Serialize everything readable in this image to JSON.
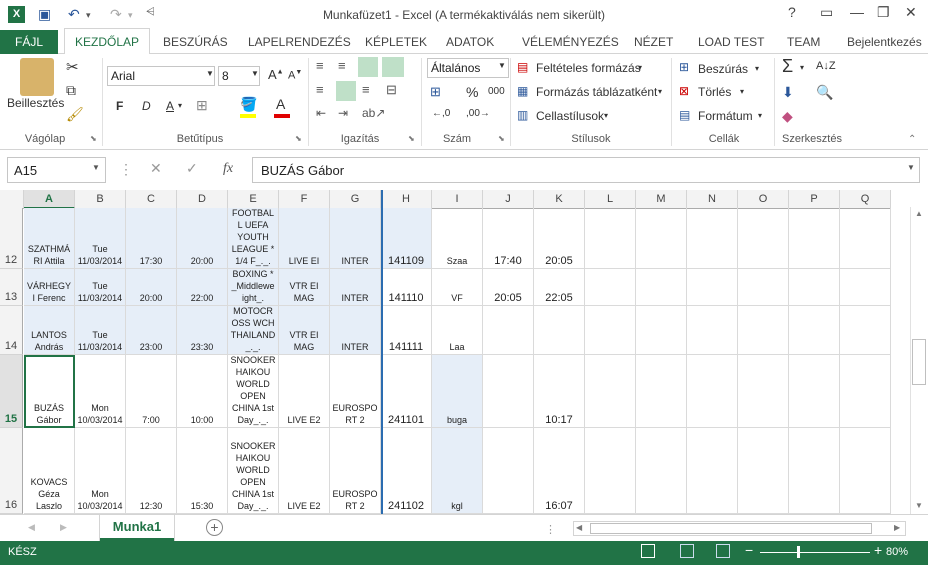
{
  "window": {
    "title": "Munkafüzet1 - Excel (A termékaktiválás nem sikerült)",
    "help": "?",
    "minimize": "—",
    "restore": "❐",
    "close": "✕"
  },
  "qat": {
    "excel_icon": "X",
    "save": "💾",
    "undo": "↶",
    "redo": "↷",
    "more": "⋯"
  },
  "tabs": {
    "file": "FÁJL",
    "home": "KEZDŐLAP",
    "items": [
      "BESZÚRÁS",
      "LAPELRENDEZÉS",
      "KÉPLETEK",
      "ADATOK",
      "VÉLEMÉNYEZÉS",
      "NÉZET",
      "LOAD TEST",
      "TEAM",
      "Bejelentkezés"
    ]
  },
  "ribbon": {
    "clipboard": {
      "label": "Vágólap",
      "paste": "Beillesztés"
    },
    "font": {
      "label": "Betűtípus",
      "name": "Arial",
      "size": "8",
      "bold": "F",
      "italic": "D",
      "underline": "A"
    },
    "alignment": {
      "label": "Igazítás"
    },
    "number": {
      "label": "Szám",
      "format": "Általános",
      "percent": "%",
      "comma": "000"
    },
    "styles": {
      "label": "Stílusok",
      "conditional": "Feltételes formázás",
      "table": "Formázás táblázatként",
      "cell": "Cellastílusok"
    },
    "cells": {
      "label": "Cellák",
      "insert": "Beszúrás",
      "delete": "Törlés",
      "format": "Formátum"
    },
    "editing": {
      "label": "Szerkesztés"
    }
  },
  "formula_bar": {
    "name_box": "A15",
    "fx": "fx",
    "cancel": "✕",
    "enter": "✓",
    "content": "BUZÁS   Gábor"
  },
  "columns": [
    "A",
    "B",
    "C",
    "D",
    "E",
    "F",
    "G",
    "H",
    "I",
    "J",
    "K",
    "L",
    "M",
    "N",
    "O",
    "P",
    "Q"
  ],
  "rows": [
    {
      "num": "12",
      "A": "SZATHMÁ\nRI   Attila",
      "B": "Tue\n11/03/2014",
      "C": "17:30",
      "D": "20:00",
      "E": "FOOTBAL\nL UEFA\nYOUTH\nLEAGUE *\n1/4 F_._.",
      "F": "LIVE EI",
      "G": "INTER",
      "H": "141109",
      "I": "Szaa",
      "J": "17:40",
      "K": "20:05"
    },
    {
      "num": "13",
      "A": "VÁRHEGY\nI   Ferenc",
      "B": "Tue\n11/03/2014",
      "C": "20:00",
      "D": "22:00",
      "E": "BOXING *\n_Middlewe\night_.",
      "F": "VTR EI\nMAG",
      "G": "INTER",
      "H": "141110",
      "I": "VF",
      "J": "20:05",
      "K": "22:05"
    },
    {
      "num": "14",
      "A": "LANTOS\nAndrás",
      "B": "Tue\n11/03/2014",
      "C": "23:00",
      "D": "23:30",
      "E": "MOTOCR\nOSS WCH\nTHAILAND\n_._.",
      "F": "VTR EI\nMAG",
      "G": "INTER",
      "H": "141111",
      "I": "Laa",
      "J": "",
      "K": ""
    },
    {
      "num": "15",
      "A": "BUZÁS\nGábor",
      "B": "Mon\n10/03/2014",
      "C": "7:00",
      "D": "10:00",
      "E": "SNOOKER\nHAIKOU\nWORLD\nOPEN\nCHINA 1st\nDay_._.",
      "F": "LIVE E2",
      "G": "EUROSPO\nRT 2",
      "H": "241101",
      "I": "buga",
      "J": "",
      "K": "10:17"
    },
    {
      "num": "16",
      "A": "KOVACS\nGéza\nLaszlo",
      "B": "Mon\n10/03/2014",
      "C": "12:30",
      "D": "15:30",
      "E": "SNOOKER\nHAIKOU\nWORLD\nOPEN\nCHINA 1st\nDay_._.",
      "F": "LIVE E2",
      "G": "EUROSPO\nRT 2",
      "H": "241102",
      "I": "kgl",
      "J": "",
      "K": "16:07"
    }
  ],
  "sheet": {
    "tab": "Munka1",
    "add": "+"
  },
  "status": {
    "ready": "KÉSZ",
    "zoom": "80%",
    "minus": "−",
    "plus": "+"
  },
  "colors": {
    "accent": "#217346",
    "selection": "#e6eef8"
  }
}
